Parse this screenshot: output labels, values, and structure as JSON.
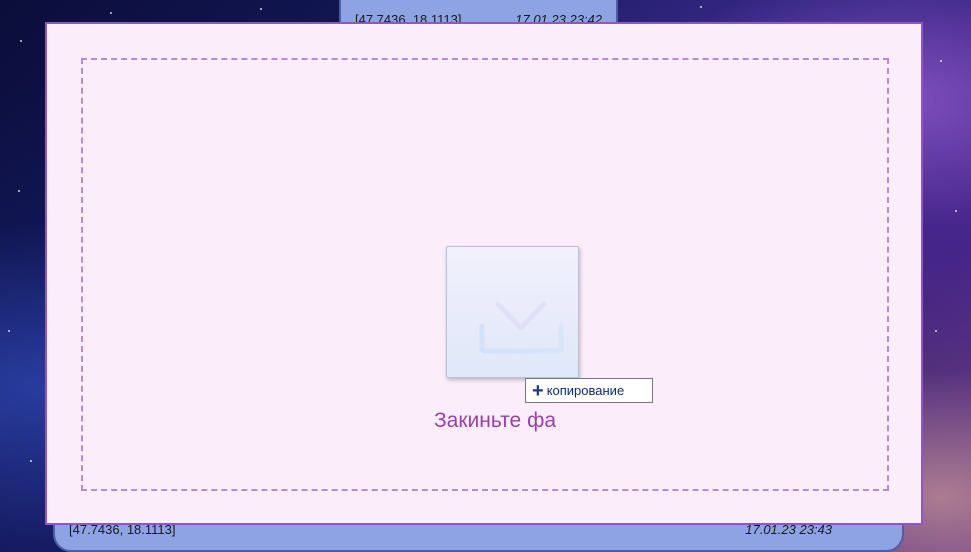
{
  "background_cards": {
    "top": {
      "coords": "[47.7436, 18.1113]",
      "time": "17.01.23 23:42"
    },
    "bottom": {
      "coords": "[47.7436, 18.1113]",
      "time": "17.01.23 23:43"
    }
  },
  "drop_zone": {
    "text": "Закиньте фа",
    "icon": "download-tray-icon"
  },
  "drag_ghost": {
    "icon": "file-ghost-icon"
  },
  "copy_tooltip": {
    "icon": "plus-icon",
    "label": "копирование"
  },
  "colors": {
    "overlay_bg": "#fbeefa",
    "overlay_border": "#8f56c8",
    "dashed_border": "#b48ae0",
    "drop_text": "#9b3fab",
    "card_bg": "#8ea3e3"
  }
}
